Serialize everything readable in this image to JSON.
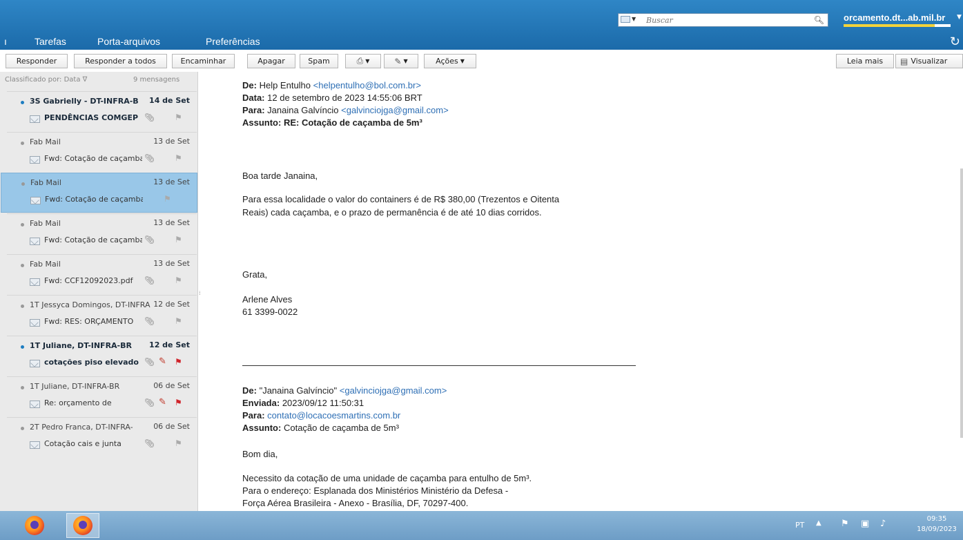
{
  "header": {
    "search_placeholder": "Buscar",
    "account": "orcamento.dt...ab.mil.br",
    "quota_fraction": 0.85
  },
  "nav": {
    "tabs": [
      "Tarefas",
      "Porta-arquivos",
      "Preferências"
    ]
  },
  "toolbar": {
    "reply": "Responder",
    "reply_all": "Responder a todos",
    "forward": "Encaminhar",
    "delete": "Apagar",
    "spam": "Spam",
    "actions": "Ações",
    "read_more": "Leia mais",
    "view": "Visualizar"
  },
  "list": {
    "sort_label": "Classificado por: Data",
    "count_label": "9 mensagens",
    "messages": [
      {
        "sender": "3S Gabrielly - DT-INFRA-B",
        "date": "14 de Set",
        "subject": "PENDÊNCIAS COMGEP",
        "unread": true,
        "tagged": false,
        "flagged": false,
        "selected": false
      },
      {
        "sender": "Fab Mail",
        "date": "13 de Set",
        "subject": "Fwd: Cotação de caçamba",
        "unread": false,
        "tagged": false,
        "flagged": false,
        "selected": false
      },
      {
        "sender": "Fab Mail",
        "date": "13 de Set",
        "subject": "Fwd: Cotação de caçamba de",
        "unread": false,
        "tagged": false,
        "flagged": false,
        "selected": true
      },
      {
        "sender": "Fab Mail",
        "date": "13 de Set",
        "subject": "Fwd: Cotação de caçamba",
        "unread": false,
        "tagged": false,
        "flagged": false,
        "selected": false
      },
      {
        "sender": "Fab Mail",
        "date": "13 de Set",
        "subject": "Fwd: CCF12092023.pdf",
        "unread": false,
        "tagged": false,
        "flagged": false,
        "selected": false
      },
      {
        "sender": "1T Jessyca Domingos, DT-INFRA",
        "date": "12 de Set",
        "subject": "Fwd: RES: ORÇAMENTO",
        "unread": false,
        "tagged": false,
        "flagged": false,
        "selected": false
      },
      {
        "sender": "1T Juliane, DT-INFRA-BR",
        "date": "12 de Set",
        "subject": "cotações piso elevado",
        "unread": true,
        "tagged": true,
        "flagged": true,
        "selected": false
      },
      {
        "sender": "1T Juliane, DT-INFRA-BR",
        "date": "06 de Set",
        "subject": "Re: orçamento de",
        "unread": false,
        "tagged": true,
        "flagged": true,
        "selected": false
      },
      {
        "sender": "2T Pedro Franca, DT-INFRA-",
        "date": "06 de Set",
        "subject": "Cotação cais e junta",
        "unread": false,
        "tagged": false,
        "flagged": false,
        "selected": false
      }
    ]
  },
  "email": {
    "from_label": "De:",
    "from_name": "Help Entulho",
    "from_email": "<helpentulho@bol.com.br>",
    "date_label": "Data:",
    "date_value": "12 de setembro de 2023 14:55:06 BRT",
    "to_label": "Para:",
    "to_name": "Janaina Galvíncio",
    "to_email": "<galvinciojga@gmail.com>",
    "subject_label": "Assunto:",
    "subject_value": "RE: Cotação de caçamba de 5m³",
    "greeting": "Boa tarde Janaina,",
    "body_1": "Para essa localidade o valor do containers é de R$ 380,00 (Trezentos e Oitenta",
    "body_2": "Reais) cada caçamba, e o prazo de permanência é de até 10 dias corridos.",
    "closing": "Grata,",
    "signature_name": "Arlene Alves",
    "signature_phone": "61 3399-0022",
    "q_from_label": "De:",
    "q_from_name": "\"Janaina Galvíncio\"",
    "q_from_email": "<galvinciojga@gmail.com>",
    "q_sent_label": "Enviada:",
    "q_sent_value": "2023/09/12 11:50:31",
    "q_to_label": "Para:",
    "q_to_email": "contato@locacoesmartins.com.br",
    "q_subject_label": "Assunto:",
    "q_subject_value": "Cotação de caçamba de 5m³",
    "q_greeting": "Bom dia,",
    "q_body_1": "Necessito da cotação de uma unidade de caçamba para entulho de 5m³.",
    "q_body_2": "Para o endereço: Esplanada dos Ministérios Ministério da Defesa -",
    "q_body_3": "Força Aérea Brasileira - Anexo - Brasília, DF, 70297-400."
  },
  "taskbar": {
    "lang": "PT",
    "time": "09:35",
    "date": "18/09/2023"
  }
}
